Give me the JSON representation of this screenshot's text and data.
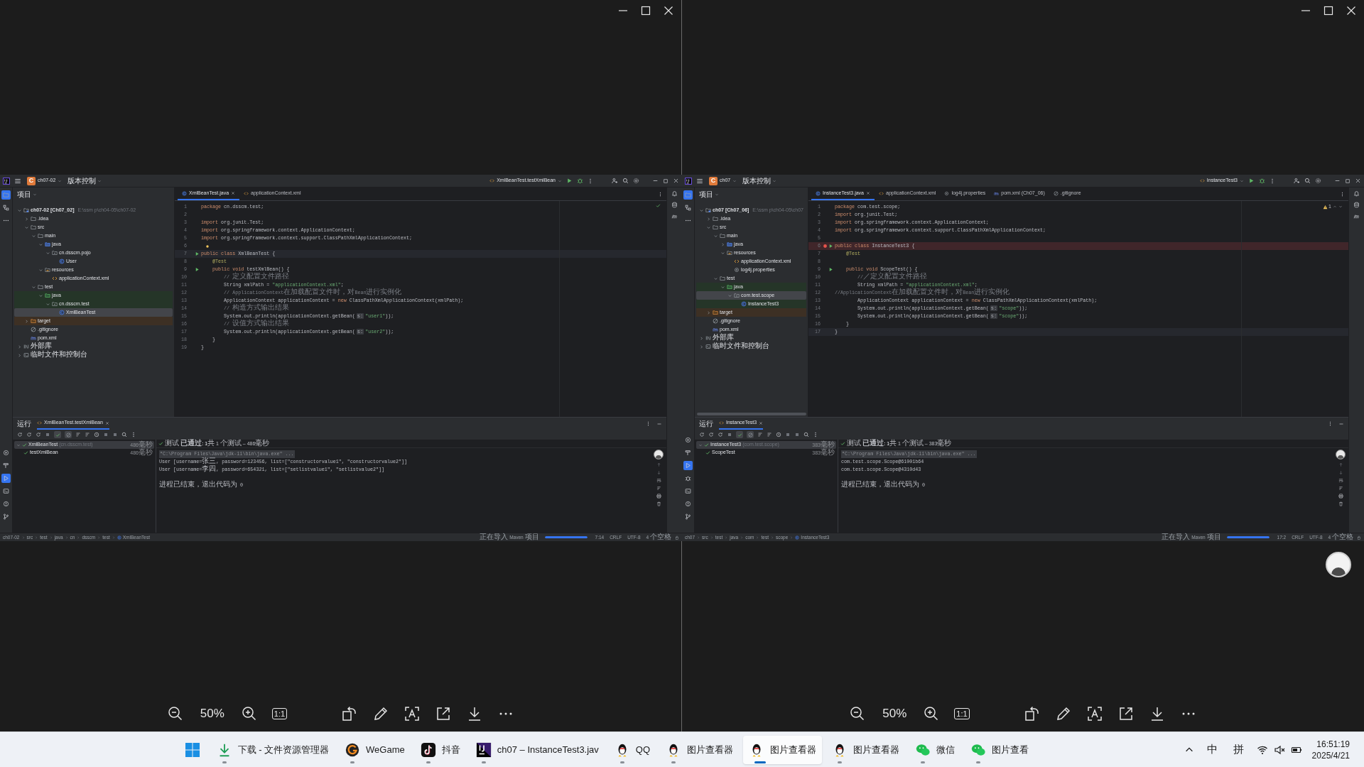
{
  "viewers": [
    {
      "ide": {
        "project_initial": "C",
        "project": "ch07-02",
        "vcs": "版本控制",
        "run_config": "XmlBeanTest.testXmlBean",
        "panel_title": "项目",
        "tool_strip_top": [
          {
            "kind": "project",
            "selected": true
          },
          {
            "kind": "structure",
            "selected": false
          },
          {
            "kind": "more",
            "selected": false
          }
        ],
        "tool_strip_bottom": [
          {
            "kind": "services",
            "selected": false
          },
          {
            "kind": "build",
            "selected": false
          },
          {
            "kind": "run",
            "selected": true
          },
          {
            "kind": "terminal",
            "selected": false
          },
          {
            "kind": "problems",
            "selected": false
          },
          {
            "kind": "git",
            "selected": false
          }
        ],
        "tree": [
          {
            "label": "ch07-02 [Ch07_02]",
            "path": "E:\\ssm p\\ch04-05\\ch07-02",
            "kind": "module",
            "expanded": true,
            "selected": false,
            "children": [
              {
                "label": ".idea",
                "kind": "folder",
                "expanded": false,
                "selected": false
              },
              {
                "label": "src",
                "kind": "folder",
                "expanded": true,
                "selected": false,
                "children": [
                  {
                    "label": "main",
                    "kind": "folder",
                    "expanded": true,
                    "selected": false,
                    "children": [
                      {
                        "label": "java",
                        "kind": "source",
                        "expanded": true,
                        "selected": false,
                        "children": [
                          {
                            "label": "cn.dsscm.pojo",
                            "kind": "package",
                            "expanded": true,
                            "selected": false,
                            "children": [
                              {
                                "label": "User",
                                "kind": "class",
                                "selected": false
                              }
                            ]
                          }
                        ]
                      },
                      {
                        "label": "resources",
                        "kind": "resources",
                        "expanded": true,
                        "selected": false,
                        "children": [
                          {
                            "label": "applicationContext.xml",
                            "kind": "xml",
                            "selected": false
                          }
                        ]
                      }
                    ]
                  },
                  {
                    "label": "test",
                    "kind": "folder",
                    "expanded": true,
                    "selected": false,
                    "children": [
                      {
                        "label": "java",
                        "kind": "test",
                        "color": "#253528",
                        "expanded": true,
                        "selected": false,
                        "children": [
                          {
                            "label": "cn.dsscm.test",
                            "kind": "package",
                            "color": "#253528",
                            "expanded": true,
                            "selected": false,
                            "children": [
                              {
                                "label": "XmlBeanTest",
                                "kind": "class",
                                "selected": true
                              }
                            ]
                          }
                        ]
                      }
                    ]
                  }
                ]
              },
              {
                "label": "target",
                "kind": "excluded",
                "color": "#3d3024",
                "expanded": false,
                "selected": false
              },
              {
                "label": ".gitignore",
                "kind": "gitignore",
                "selected": false
              },
              {
                "label": "pom.xml",
                "kind": "maven",
                "selected": false
              }
            ]
          },
          {
            "label": "外部库",
            "kind": "library",
            "expanded": false,
            "selected": false
          },
          {
            "label": "临时文件和控制台",
            "kind": "scratch",
            "expanded": false,
            "selected": false
          }
        ],
        "tabs": [
          {
            "label": "XmlBeanTest.java",
            "kind": "class",
            "selected": true
          },
          {
            "label": "applicationContext.xml",
            "kind": "xml",
            "selected": false
          }
        ],
        "inspection": {
          "kind": "ok"
        },
        "lines": [
          {
            "n": "1",
            "code": "package cn.dsscm.test;",
            "kind": "plain",
            "current": false
          },
          {
            "n": "2",
            "kind": "plain",
            "current": false
          },
          {
            "n": "3",
            "code": "import org.junit.Test;",
            "kind": "plain",
            "current": false
          },
          {
            "n": "4",
            "code": "import org.springframework.context.ApplicationContext;",
            "kind": "plain",
            "current": false
          },
          {
            "n": "5",
            "code": "import org.springframework.context.support.ClassPathXmlApplicationContext;",
            "kind": "plain",
            "current": false
          },
          {
            "n": "6",
            "kind": "bulb",
            "current": false
          },
          {
            "n": "7",
            "code": "public class XmlBeanTest {",
            "kind": "run",
            "current": true
          },
          {
            "n": "8",
            "code": "    @Test",
            "kind": "plain",
            "current": false
          },
          {
            "n": "9",
            "code": "    public void testXmlBean() {",
            "kind": "run",
            "current": false
          },
          {
            "n": "10",
            "code": "        // 定义配置文件路径",
            "kind": "plain",
            "current": false
          },
          {
            "n": "11",
            "code": "        String xmlPath = \"applicationContext.xml\";",
            "kind": "plain",
            "current": false
          },
          {
            "n": "12",
            "code": "        // ApplicationContext在加载配置文件时，对Bean进行实例化",
            "kind": "plain",
            "current": false
          },
          {
            "n": "13",
            "code": "        ApplicationContext applicationContext = new ClassPathXmlApplicationContext(xmlPath);",
            "kind": "plain",
            "current": false
          },
          {
            "n": "14",
            "code": "        // 构造方式输出结果",
            "kind": "plain",
            "current": false
          },
          {
            "n": "15",
            "code": "        System.out.println(applicationContext.getBean(",
            "hint": "s:",
            "code_after": "\"user1\"));",
            "kind": "plain",
            "current": false
          },
          {
            "n": "16",
            "code": "        // 设值方式输出结果",
            "kind": "plain",
            "current": false
          },
          {
            "n": "17",
            "code": "        System.out.println(applicationContext.getBean(",
            "hint": "s:",
            "code_after": "\"user2\"));",
            "kind": "plain",
            "current": false
          },
          {
            "n": "18",
            "code": "    }",
            "kind": "plain",
            "current": false
          },
          {
            "n": "19",
            "code": "}",
            "kind": "plain",
            "current": false
          }
        ],
        "run": {
          "title": "运行",
          "tab": "XmlBeanTest.testXmlBean",
          "summary": "测试 **已通过: 1**共 1 个测试 – 486毫秒",
          "tests": [
            {
              "name": "XmlBeanTest",
              "package": "(cn.dsscm.test)",
              "time": "486毫秒",
              "selected": true,
              "children": [
                {
                  "name": "testXmlBean",
                  "time": "486毫秒",
                  "selected": false
                }
              ]
            }
          ],
          "console": [
            {
              "text": "\"C:\\Program Files\\Java\\jdk-11\\bin\\java.exe\" ...",
              "kind": "command"
            },
            {
              "text": "User [username=张三, password=123456, list=[\"constructorvalue1\", \"constructorvalue2\"]]",
              "kind": "output"
            },
            {
              "text": "User [username=李四, password=654321, list=[\"setlistvalue1\", \"setlistvalue2\"]]",
              "kind": "output"
            },
            {
              "text": "进程已结束，退出代码为 0",
              "kind": "exit"
            }
          ]
        },
        "status": {
          "path": [
            "ch07-02",
            "src",
            "test",
            "java",
            "cn",
            "dsscm",
            "test",
            "XmlBeanTest"
          ],
          "task": "正在导入 Maven 项目",
          "level": 1,
          "position": "7:14",
          "line_separator": "CRLF",
          "encoding": "UTF-8",
          "indent": "4 个空格"
        }
      },
      "zoom": "50%",
      "actual_size": "1:1"
    },
    {
      "ide": {
        "project_initial": "C",
        "project": "ch07",
        "vcs": "版本控制",
        "run_config": "InstanceTest3",
        "panel_title": "项目",
        "tool_strip_top": [
          {
            "kind": "project",
            "selected": true
          },
          {
            "kind": "structure",
            "selected": false
          },
          {
            "kind": "more",
            "selected": false
          }
        ],
        "tool_strip_bottom": [
          {
            "kind": "services",
            "selected": false
          },
          {
            "kind": "build",
            "selected": false
          },
          {
            "kind": "run",
            "selected": true
          },
          {
            "kind": "debug",
            "selected": false
          },
          {
            "kind": "terminal",
            "selected": false
          },
          {
            "kind": "problems",
            "selected": false
          },
          {
            "kind": "git",
            "selected": false
          }
        ],
        "tree": [
          {
            "label": "ch07 [Ch07_06]",
            "path": "E:\\ssm p\\ch04-05\\ch07",
            "kind": "module",
            "expanded": true,
            "selected": false,
            "children": [
              {
                "label": ".idea",
                "kind": "folder",
                "expanded": false,
                "selected": false
              },
              {
                "label": "src",
                "kind": "folder",
                "expanded": true,
                "selected": false,
                "children": [
                  {
                    "label": "main",
                    "kind": "folder",
                    "expanded": true,
                    "selected": false,
                    "children": [
                      {
                        "label": "java",
                        "kind": "source",
                        "expanded": false,
                        "selected": false
                      },
                      {
                        "label": "resources",
                        "kind": "resources",
                        "expanded": true,
                        "selected": false,
                        "children": [
                          {
                            "label": "applicationContext.xml",
                            "kind": "xml",
                            "selected": false
                          },
                          {
                            "label": "log4j.properties",
                            "kind": "properties",
                            "selected": false
                          }
                        ]
                      }
                    ]
                  },
                  {
                    "label": "test",
                    "kind": "folder",
                    "expanded": true,
                    "selected": false,
                    "children": [
                      {
                        "label": "java",
                        "kind": "test",
                        "color": "#253528",
                        "expanded": true,
                        "selected": false,
                        "children": [
                          {
                            "label": "com.test.scope",
                            "kind": "package",
                            "expanded": true,
                            "selected": true,
                            "children": [
                              {
                                "label": "InstanceTest3",
                                "kind": "class",
                                "color": "#253528",
                                "selected": false
                              }
                            ]
                          }
                        ]
                      }
                    ]
                  }
                ]
              },
              {
                "label": "target",
                "kind": "excluded",
                "color": "#3d3024",
                "expanded": false,
                "selected": false
              },
              {
                "label": ".gitignore",
                "kind": "gitignore",
                "selected": false
              },
              {
                "label": "pom.xml",
                "kind": "maven",
                "selected": false
              }
            ]
          },
          {
            "label": "外部库",
            "kind": "library",
            "expanded": false,
            "selected": false
          },
          {
            "label": "临时文件和控制台",
            "kind": "scratch",
            "expanded": false,
            "selected": false
          }
        ],
        "tabs": [
          {
            "label": "InstanceTest3.java",
            "kind": "class",
            "selected": true
          },
          {
            "label": "applicationContext.xml",
            "kind": "xml",
            "selected": false
          },
          {
            "label": "log4j.properties",
            "kind": "properties",
            "selected": false
          },
          {
            "label": "pom.xml (Ch07_06)",
            "kind": "maven",
            "selected": false
          },
          {
            "label": ".gitignore",
            "kind": "gitignore",
            "selected": false
          }
        ],
        "inspection": {
          "kind": "warning",
          "count": "1"
        },
        "lines": [
          {
            "n": "1",
            "code": "package com.test.scope;",
            "kind": "plain",
            "current": false
          },
          {
            "n": "2",
            "code": "import org.junit.Test;",
            "kind": "plain",
            "current": false
          },
          {
            "n": "3",
            "code": "import org.springframework.context.ApplicationContext;",
            "kind": "plain",
            "current": false
          },
          {
            "n": "4",
            "code": "import org.springframework.context.support.ClassPathXmlApplicationContext;",
            "kind": "plain",
            "current": false
          },
          {
            "n": "5",
            "kind": "plain",
            "current": false
          },
          {
            "n": "6",
            "code": "public class InstanceTest3 {",
            "kind": "breakpoint",
            "current": false
          },
          {
            "n": "7",
            "code": "    @Test",
            "kind": "plain",
            "current": false
          },
          {
            "n": "8",
            "kind": "plain",
            "current": false
          },
          {
            "n": "9",
            "code": "    public void ScopeTest() {",
            "kind": "run",
            "current": false
          },
          {
            "n": "10",
            "code": "        //／定义配置文件路径",
            "kind": "plain",
            "current": false
          },
          {
            "n": "11",
            "code": "        String xmlPath = \"applicationContext.xml\";",
            "kind": "plain",
            "current": false
          },
          {
            "n": "12",
            "code": "//ApplicationContext在加载配置文件时，对Bean进行实例化",
            "kind": "plain",
            "current": false
          },
          {
            "n": "13",
            "code": "        ApplicationContext applicationContext = new ClassPathXmlApplicationContext(xmlPath);",
            "kind": "plain",
            "current": false
          },
          {
            "n": "14",
            "code": "        System.out.println(applicationContext.getBean(",
            "hint": "s:",
            "code_after": "\"scope\"));",
            "kind": "plain",
            "current": false
          },
          {
            "n": "15",
            "code": "        System.out.println(applicationContext.getBean(",
            "hint": "s:",
            "code_after": "\"scope\"));",
            "kind": "plain",
            "current": false
          },
          {
            "n": "16",
            "code": "    }",
            "kind": "plain",
            "current": false
          },
          {
            "n": "17",
            "code": "}",
            "kind": "plain",
            "current": true
          }
        ],
        "run": {
          "title": "运行",
          "tab": "InstanceTest3",
          "summary": "测试 **已通过: 1**共 1 个测试 – 383毫秒",
          "tests": [
            {
              "name": "InstanceTest3",
              "package": "(com.test.scope)",
              "time": "383毫秒",
              "selected": true,
              "children": [
                {
                  "name": "ScopeTest",
                  "time": "383毫秒",
                  "selected": false
                }
              ]
            }
          ],
          "console": [
            {
              "text": "\"C:\\Program Files\\Java\\jdk-11\\bin\\java.exe\" ...",
              "kind": "command"
            },
            {
              "text": "com.test.scope.Scope@61001b64",
              "kind": "output"
            },
            {
              "text": "com.test.scope.Scope@4310d43",
              "kind": "output"
            },
            {
              "text": "进程已结束，退出代码为 0",
              "kind": "exit"
            }
          ]
        },
        "status": {
          "path": [
            "ch07",
            "src",
            "test",
            "java",
            "com",
            "test",
            "scope",
            "InstanceTest3"
          ],
          "task": "正在导入 Maven 项目",
          "level": 1,
          "position": "17:2",
          "line_separator": "CRLF",
          "encoding": "UTF-8",
          "indent": "4 个空格"
        }
      },
      "zoom": "50%",
      "actual_size": "1:1"
    }
  ],
  "taskbar": {
    "items": [
      {
        "label": "下载 - 文件资源管理器",
        "kind": "download",
        "selected": false
      },
      {
        "label": "WeGame",
        "kind": "wegame",
        "selected": false
      },
      {
        "label": "抖音",
        "kind": "douyin",
        "selected": false
      },
      {
        "label": "ch07 – InstanceTest3.jav",
        "kind": "ide",
        "selected": false
      },
      {
        "label": "QQ",
        "kind": "qq",
        "selected": false
      },
      {
        "label": "图片查看器",
        "kind": "qq",
        "selected": false
      },
      {
        "label": "图片查看器",
        "kind": "qq",
        "selected": true
      },
      {
        "label": "图片查看器",
        "kind": "qq",
        "selected": false
      },
      {
        "label": "微信",
        "kind": "wechat",
        "selected": false
      },
      {
        "label": "图片查看",
        "kind": "wechat",
        "selected": false
      }
    ],
    "input_mode": "中",
    "ime": "拼",
    "time": "16:51:19",
    "date": "2025/4/21"
  }
}
